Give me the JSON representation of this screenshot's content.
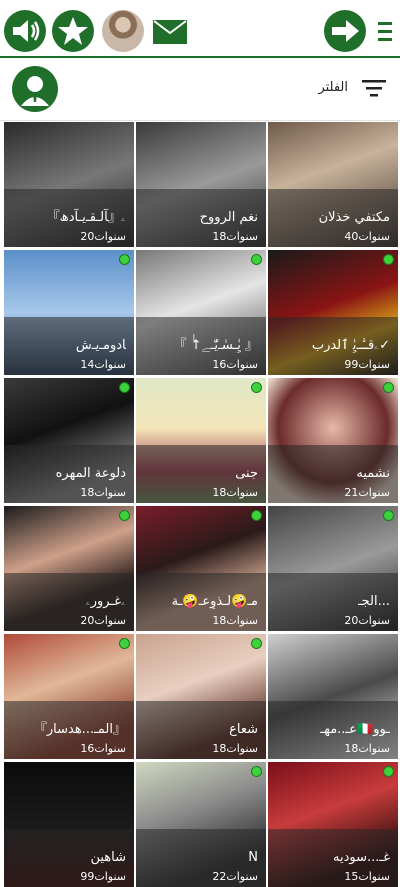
{
  "colors": {
    "accent": "#1f6f2a",
    "online": "#3dd23d"
  },
  "filter": {
    "label": "الفلتر"
  },
  "tiles": [
    {
      "name": "مكتفي خذلان",
      "age": "40سنوات",
      "online": false,
      "bg": "linear-gradient(160deg,#6f5a4a,#c8b29a 40%,#3b2f2a)"
    },
    {
      "name": "نغم الرووح",
      "age": "18سنوات",
      "online": false,
      "bg": "linear-gradient(160deg,#3a3a3a,#9a9a9a 50%,#2a2a2a)"
    },
    {
      "name": "『ﺂلـقـﯾـﺂدﮪ』ۦ",
      "age": "20سنوات",
      "online": false,
      "bg": "linear-gradient(160deg,#2b2b2b,#777 50%,#1d1d1d)"
    },
    {
      "name": "ۦقـٰ٘ـﯾِٰ ٱلدرب✓",
      "age": "99سنوات",
      "online": true,
      "bg": "linear-gradient(160deg,#1a1a1a,#8a1414 45%,#d4a017 70%,#111)"
    },
    {
      "name": "『 ↑ٰٰﯾِٰـسٰـﯾّٰـﮯ 』",
      "age": "16سنوات",
      "online": true,
      "bg": "linear-gradient(160deg,#777,#e5e5e5 45%,#3a3a3a)"
    },
    {
      "name": "ﺂﺩﻭﻣـﯾـﺵ",
      "age": "14سنوات",
      "online": true,
      "bg": "linear-gradient(180deg,#5b8fc8,#a6c8ea 50%,#2a3f5a)"
    },
    {
      "name": "نشميه",
      "age": "21سنوات",
      "online": true,
      "bg": "radial-gradient(circle at 50% 40%,#e8b8a8,#6b2b2b 55%,#e9d6c8 80%)"
    },
    {
      "name": "جنى",
      "age": "18سنوات",
      "online": true,
      "bg": "linear-gradient(180deg,#dfe8c8,#f3e5b8 40%,#a84656 75%,#6a8f5a)"
    },
    {
      "name": "دلوعة المهره",
      "age": "18سنوات",
      "online": true,
      "bg": "linear-gradient(160deg,#3a3a3a,#111 40%,#888 80%)"
    },
    {
      "name": "الجـ...",
      "age": "20سنوات",
      "online": true,
      "bg": "linear-gradient(160deg,#444,#9a9a9a 50%,#1a1a1a)"
    },
    {
      "name": "مـ🤪لـذوٍعـ🤪ـة",
      "age": "18سنوات",
      "online": true,
      "bg": "linear-gradient(160deg,#7a1d2a,#2a1a1a 40%,#c7a08a 70%)"
    },
    {
      "name": "ۦغـرورۦ",
      "age": "20سنوات",
      "online": true,
      "bg": "linear-gradient(160deg,#1b1b1b,#cfa08a 40%,#2a1e1a 70%)"
    },
    {
      "name": "عـ..مهـ🇮🇹ـوو",
      "age": "18سنوات",
      "online": false,
      "bg": "linear-gradient(160deg,#cfcfcf,#4a4a4a 50%,#efefef)"
    },
    {
      "name": "شعاع",
      "age": "18سنوات",
      "online": true,
      "bg": "linear-gradient(160deg,#c9a28e,#e8cfc0 40%,#5a2a22 80%)"
    },
    {
      "name": "『المـ...هدسار』",
      "age": "16سنوات",
      "online": true,
      "bg": "linear-gradient(160deg,#b14a3a,#e0b898 40%,#8a3a2a 80%)"
    },
    {
      "name": "غـ...سوديه",
      "age": "15سنوات",
      "online": true,
      "bg": "linear-gradient(160deg,#7a0f1a,#c83c3c 40%,#2a0a0a 80%)"
    },
    {
      "name": "N",
      "age": "22سنوات",
      "online": true,
      "bg": "linear-gradient(160deg,#cfd8c0,#8a8a8a 40%,#2a2a2a 80%)"
    },
    {
      "name": "شاهين",
      "age": "99سنوات",
      "online": false,
      "bg": "linear-gradient(180deg,#0b0b0b,#1a1a1a 50%,#3a0a0a)"
    }
  ]
}
